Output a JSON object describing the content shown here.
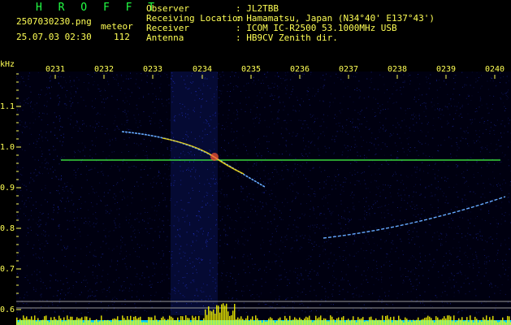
{
  "header": {
    "brand": "H R O F F T",
    "filename": "2507030230.png",
    "timestamp": "25.07.03 02:30",
    "meteor_label": "meteor",
    "meteor_count": "112",
    "fields": [
      {
        "label": "Observer",
        "value": ": JL2TBB"
      },
      {
        "label": "Receiving Location",
        "value": ": Hamamatsu, Japan (N34°40' E137°43')"
      },
      {
        "label": "Receiver",
        "value": ": ICOM IC-R2500 53.1000MHz USB"
      },
      {
        "label": "Antenna",
        "value": ": HB9CV Zenith dir."
      }
    ]
  },
  "axis": {
    "y_unit": "kHz",
    "y_ticks": [
      "1.1",
      "1.0",
      "0.9",
      "0.8",
      "0.7",
      "0.6"
    ],
    "x_ticks": [
      "0231",
      "0232",
      "0233",
      "0234",
      "0235",
      "0236",
      "0237",
      "0238",
      "0239",
      "0240"
    ]
  },
  "colors": {
    "text": "#ffff55",
    "brand": "#22ff44",
    "tick": "#ffff55",
    "baseline": "#44ff44",
    "noise": "#2233cc",
    "trace": "#66aaff",
    "hot": "#ffdd00",
    "bars": "#ffff00",
    "cyan_floor": "#00ccff"
  }
}
